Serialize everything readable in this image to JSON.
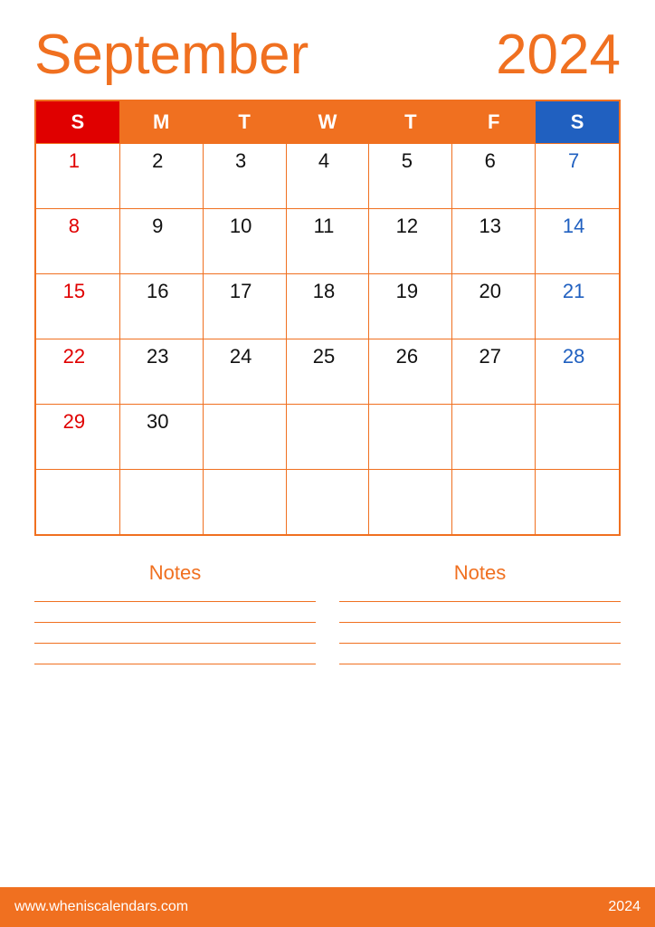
{
  "header": {
    "month": "September",
    "year": "2024"
  },
  "calendar": {
    "days_header": [
      "S",
      "M",
      "T",
      "W",
      "T",
      "F",
      "S"
    ],
    "weeks": [
      [
        "1",
        "2",
        "3",
        "4",
        "5",
        "6",
        "7"
      ],
      [
        "8",
        "9",
        "10",
        "11",
        "12",
        "13",
        "14"
      ],
      [
        "15",
        "16",
        "17",
        "18",
        "19",
        "20",
        "21"
      ],
      [
        "22",
        "23",
        "24",
        "25",
        "26",
        "27",
        "28"
      ],
      [
        "29",
        "30",
        "",
        "",
        "",
        "",
        ""
      ],
      [
        "",
        "",
        "",
        "",
        "",
        "",
        ""
      ]
    ]
  },
  "notes": {
    "left_title": "Notes",
    "right_title": "Notes"
  },
  "footer": {
    "url": "www.wheniscalendars.com",
    "year": "2024"
  }
}
